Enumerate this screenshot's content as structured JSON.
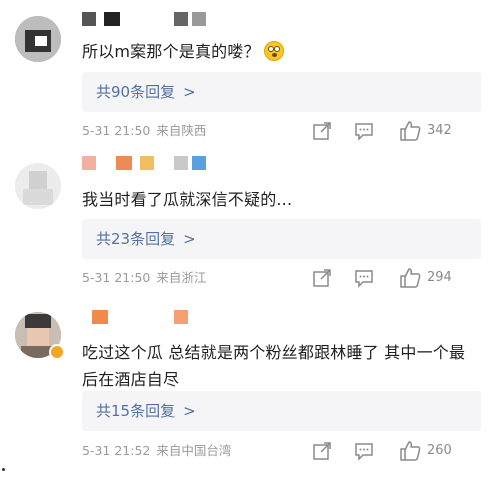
{
  "comments": [
    {
      "text": "所以m案那个是真的喽？",
      "emoji": "eyes-wide-emoji",
      "replies_label": "共90条回复",
      "chevron": ">",
      "date": "5-31 21:50",
      "location": "来自陕西",
      "likes": "342"
    },
    {
      "text": "我当时看了瓜就深信不疑的...",
      "replies_label": "共23条回复",
      "chevron": ">",
      "date": "5-31 21:50",
      "location": "来自浙江",
      "likes": "294"
    },
    {
      "text": "吃过这个瓜 总结就是两个粉丝都跟林睡了 其中一个最后在酒店自尽",
      "replies_label": "共15条回复",
      "chevron": ">",
      "date": "5-31 21:52",
      "location": "来自中国台湾",
      "likes": "260"
    }
  ],
  "colors": {
    "link": "#5470a1",
    "meta": "#9a9a9a",
    "reply_bg": "#f5f5f7",
    "badge": "#f5a623"
  },
  "icons": [
    "share-icon",
    "comment-icon",
    "like-icon",
    "verified-badge-icon"
  ]
}
